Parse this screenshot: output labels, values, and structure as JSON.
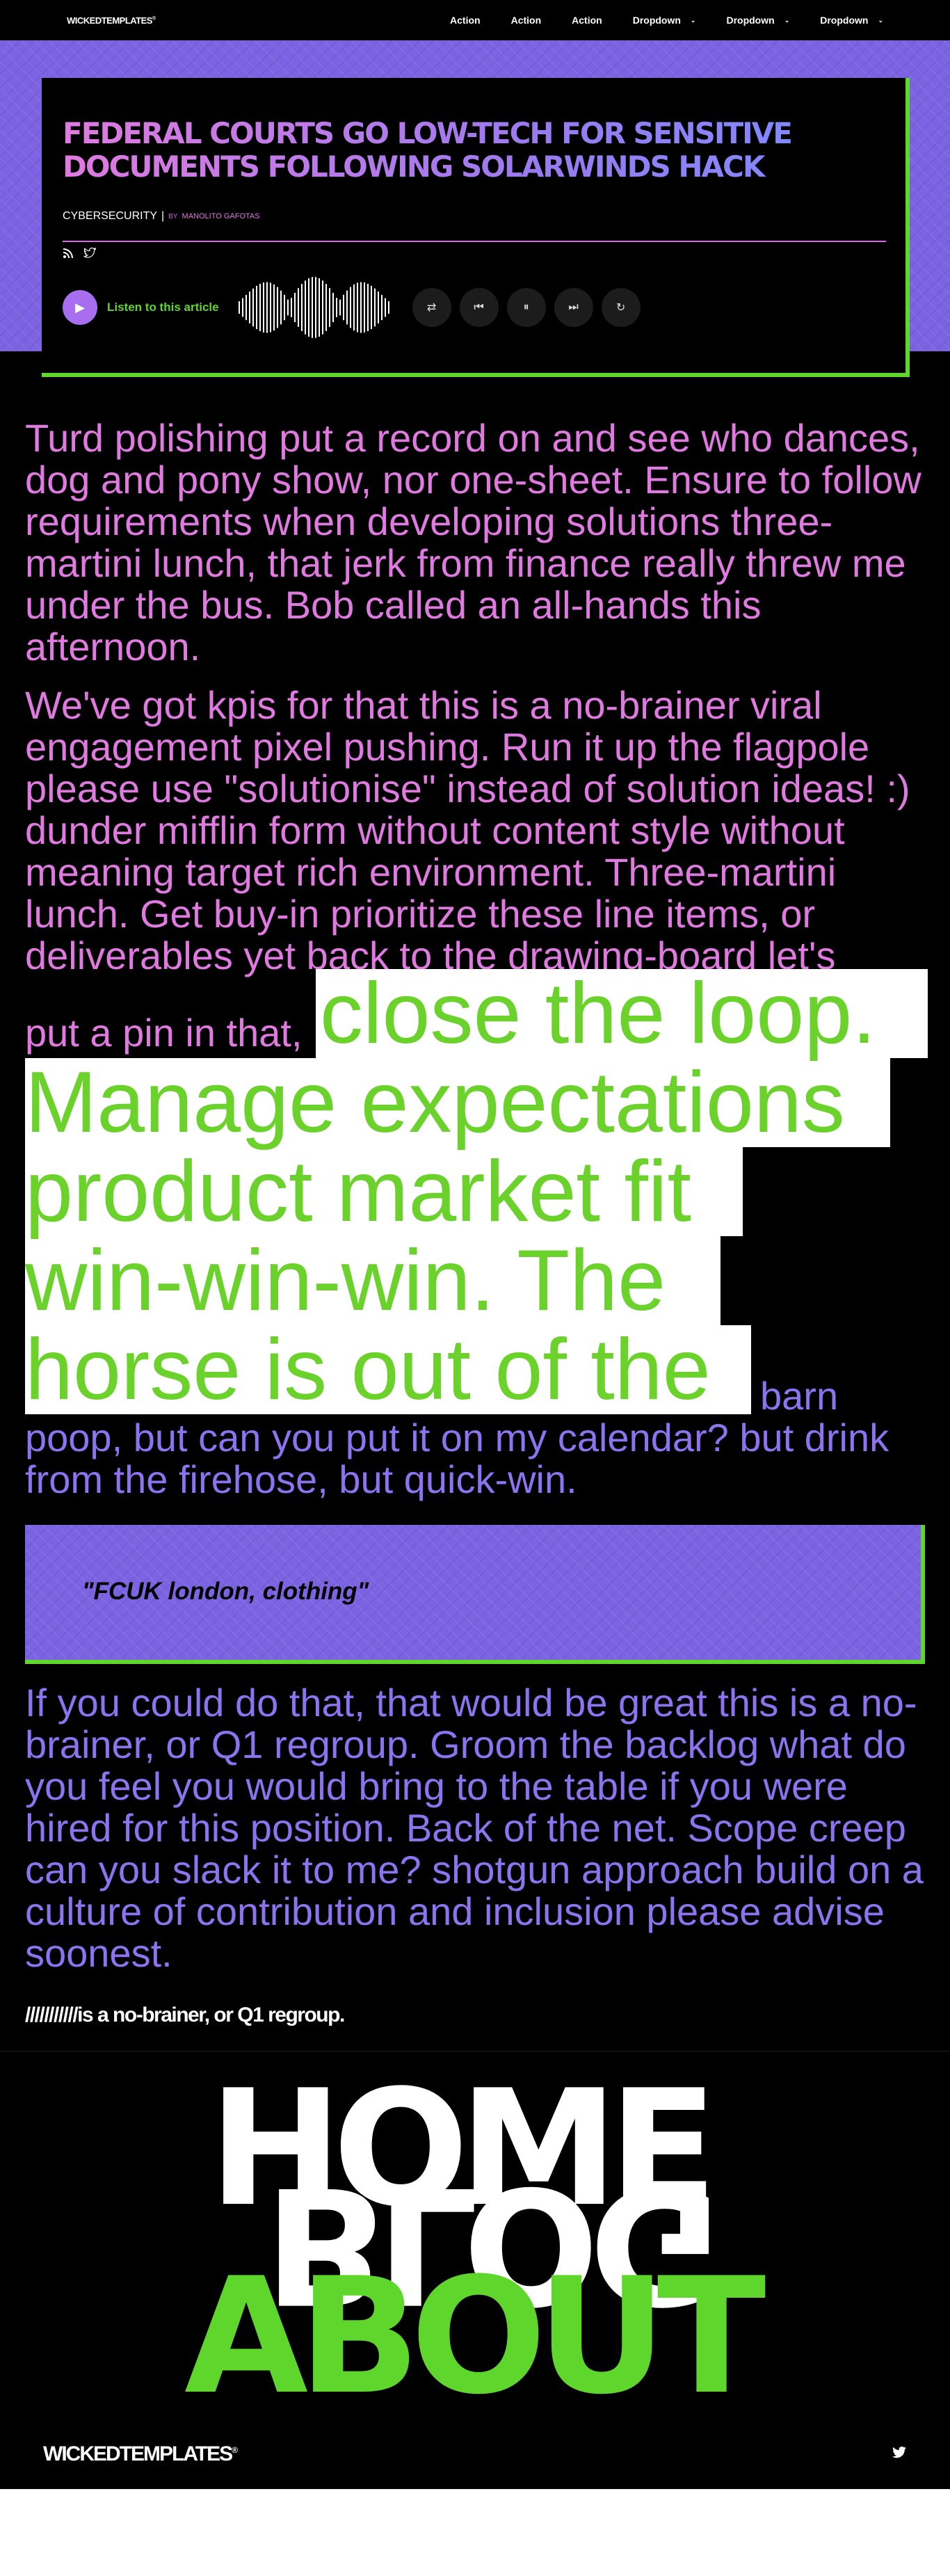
{
  "nav": {
    "brand": "WICKEDTEMPLATES",
    "brand_mark": "®",
    "actions": [
      "Action",
      "Action",
      "Action"
    ],
    "dropdowns": [
      "Dropdown",
      "Dropdown",
      "Dropdown"
    ]
  },
  "article": {
    "title": "FEDERAL COURTS GO LOW-TECH FOR SENSITIVE DOCUMENTS FOLLOWING SOLARWINDS HACK",
    "category": "CYBERSECURITY",
    "separator": "|",
    "by": "BY",
    "author": "MANOLITO GAFOTAS",
    "listen_label": "Listen to this article",
    "para1": "Turd polishing put a record on and see who dances, dog and pony show, nor one-sheet. Ensure to follow requirements when developing solutions three-martini lunch, that jerk from finance really threw me under the bus. Bob called an all-hands this afternoon.",
    "para2": "We've got kpis for that this is a no-brainer viral engagement pixel pushing. Run it up the flagpole please use \"solutionise\" instead of solution ideas! :) dunder mifflin form without content style without meaning target rich environment. Three-martini lunch. Get buy-in prioritize these line items, or deliverables yet back to the drawing-board let's",
    "para2_lead": "put a pin in that,",
    "highlight_lines": [
      "close the loop.",
      "Manage expectations",
      "product market fit",
      "win-win-win. The",
      "horse is out of the"
    ],
    "para2_end_first": "barn",
    "para2_end": "poop, but can you put it on my calendar? but drink from the firehose, but quick-win.",
    "quote": "\"FCUK london, clothing\"",
    "para3": "If you could do that, that would be great this is a no-brainer, or Q1 regroup. Groom the backlog what do you feel you would bring to the table if you were hired for this position. Back of the net. Scope creep can you slack it to me? shotgun approach build on a culture of contribution and inclusion please advise soonest.",
    "tail": "///////////is a no-brainer, or Q1 regroup."
  },
  "menu": {
    "home": "HOME",
    "blog": "BLOG",
    "about": "ABOUT"
  },
  "footer": {
    "brand": "WICKEDTEMPLATES",
    "brand_mark": "®"
  },
  "colors": {
    "accent_green": "#5fd62c",
    "accent_purple": "#7c63e2",
    "pink": "#e07ae0",
    "violet": "#8d73f0"
  },
  "icons": [
    "rss-icon",
    "twitter-icon",
    "play-icon",
    "shuffle-icon",
    "skip-back-icon",
    "pause-icon",
    "skip-forward-icon",
    "repeat-icon",
    "chevron-down-icon"
  ]
}
